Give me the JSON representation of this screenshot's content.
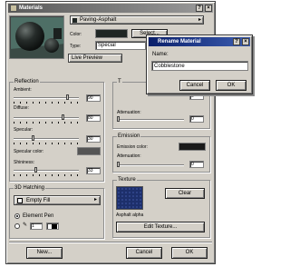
{
  "window": {
    "title": "Materials"
  },
  "material_select": "Paving-Asphalt",
  "color_label": "Color:",
  "color_button": "Select...",
  "type_label": "Type:",
  "type_value": "Special",
  "preview_select": "Live Preview",
  "reflection": {
    "title": "Reflection",
    "ambient_label": "Ambient:",
    "ambient_value": "90",
    "diffuse_label": "Diffuse:",
    "diffuse_value": "80",
    "specular_label": "Specular:",
    "specular_value": "30",
    "specular_color_label": "Specular color:",
    "shininess_label": "Shininess:",
    "shininess_value": "33"
  },
  "transparency": {
    "title": "T",
    "value1": "0",
    "attenuation_label": "Attenuation:",
    "attenuation_value": "0",
    "value3": "0"
  },
  "emission": {
    "title": "Emission",
    "color_label": "Emission color:",
    "attenuation_label": "Attenuation:",
    "attenuation_value": "0"
  },
  "texture": {
    "title": "Texture",
    "clear_button": "Clear",
    "name": "Asphalt alpha",
    "edit_button": "Edit Texture..."
  },
  "hatching": {
    "title": "3D Hatching",
    "fill_select": "Empty Fill",
    "element_pen_label": "Element Pen",
    "pen_value": "1"
  },
  "footer": {
    "new_button": "New...",
    "cancel_button": "Cancel",
    "ok_button": "OK"
  },
  "rename_dialog": {
    "title": "Rename Material",
    "name_label": "Name:",
    "name_value": "Cobblestone",
    "cancel_button": "Cancel",
    "ok_button": "OK"
  },
  "colors": {
    "swatch_dark": "#1f2624",
    "texture_blue": "#1d2f6b",
    "preview_bg": "#4e6f66"
  }
}
